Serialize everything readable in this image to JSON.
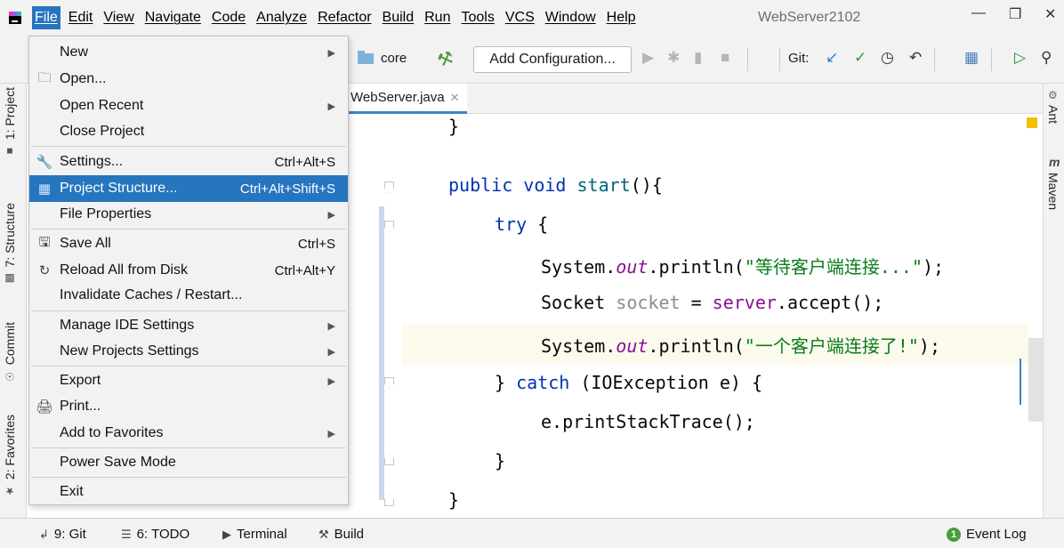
{
  "menubar": {
    "items": [
      "File",
      "Edit",
      "View",
      "Navigate",
      "Code",
      "Analyze",
      "Refactor",
      "Build",
      "Run",
      "Tools",
      "VCS",
      "Window",
      "Help"
    ],
    "active": "File",
    "project_title": "WebServer2102",
    "window_controls": [
      "minimize-icon",
      "restore-icon",
      "close-icon"
    ]
  },
  "toolbar": {
    "breadcrumb": "core",
    "add_configuration": "Add Configuration...",
    "git_label": "Git:"
  },
  "editor": {
    "tab_label": "WebServer.java",
    "lines": [
      {
        "indent": 0,
        "text": "}"
      },
      {
        "indent": 1,
        "text": "public void start(){"
      },
      {
        "indent": 2,
        "text": "try {"
      },
      {
        "indent": 3,
        "text": "System.out.println(\"等待客户端连接...\");"
      },
      {
        "indent": 3,
        "text": "Socket socket = server.accept();"
      },
      {
        "indent": 3,
        "text": "System.out.println(\"一个客户端连接了!\");"
      },
      {
        "indent": 2,
        "text": "} catch (IOException e) {"
      },
      {
        "indent": 3,
        "text": "e.printStackTrace();"
      },
      {
        "indent": 2,
        "text": "}"
      },
      {
        "indent": 1,
        "text": "}"
      }
    ]
  },
  "left_tool_windows": [
    "1: Project",
    "7: Structure",
    "Commit",
    "2: Favorites"
  ],
  "right_tool_windows": [
    "Ant",
    "Maven"
  ],
  "statusbar": {
    "git": "9: Git",
    "todo": "6: TODO",
    "terminal": "Terminal",
    "build": "Build",
    "event_log": "Event Log",
    "event_count": "1"
  },
  "file_menu": {
    "items": [
      {
        "label": "New",
        "shortcut": "",
        "submenu": true,
        "icon": ""
      },
      {
        "label": "Open...",
        "shortcut": "",
        "submenu": false,
        "icon": "folder-icon"
      },
      {
        "label": "Open Recent",
        "shortcut": "",
        "submenu": true,
        "icon": ""
      },
      {
        "label": "Close Project",
        "shortcut": "",
        "submenu": false,
        "icon": ""
      },
      {
        "label": "Settings...",
        "shortcut": "Ctrl+Alt+S",
        "submenu": false,
        "icon": "wrench-icon"
      },
      {
        "label": "Project Structure...",
        "shortcut": "Ctrl+Alt+Shift+S",
        "submenu": false,
        "icon": "project-structure-icon",
        "selected": true
      },
      {
        "label": "File Properties",
        "shortcut": "",
        "submenu": true,
        "icon": ""
      },
      {
        "label": "Save All",
        "shortcut": "Ctrl+S",
        "submenu": false,
        "icon": "save-icon"
      },
      {
        "label": "Reload All from Disk",
        "shortcut": "Ctrl+Alt+Y",
        "submenu": false,
        "icon": "reload-icon"
      },
      {
        "label": "Invalidate Caches / Restart...",
        "shortcut": "",
        "submenu": false,
        "icon": ""
      },
      {
        "label": "Manage IDE Settings",
        "shortcut": "",
        "submenu": true,
        "icon": ""
      },
      {
        "label": "New Projects Settings",
        "shortcut": "",
        "submenu": true,
        "icon": ""
      },
      {
        "label": "Export",
        "shortcut": "",
        "submenu": true,
        "icon": ""
      },
      {
        "label": "Print...",
        "shortcut": "",
        "submenu": false,
        "icon": "print-icon"
      },
      {
        "label": "Add to Favorites",
        "shortcut": "",
        "submenu": true,
        "icon": ""
      },
      {
        "label": "Power Save Mode",
        "shortcut": "",
        "submenu": false,
        "icon": ""
      },
      {
        "label": "Exit",
        "shortcut": "",
        "submenu": false,
        "icon": ""
      }
    ]
  },
  "colors": {
    "selection": "#2675bf",
    "keyword": "#0033b3",
    "string": "#067d17",
    "field": "#871094"
  }
}
